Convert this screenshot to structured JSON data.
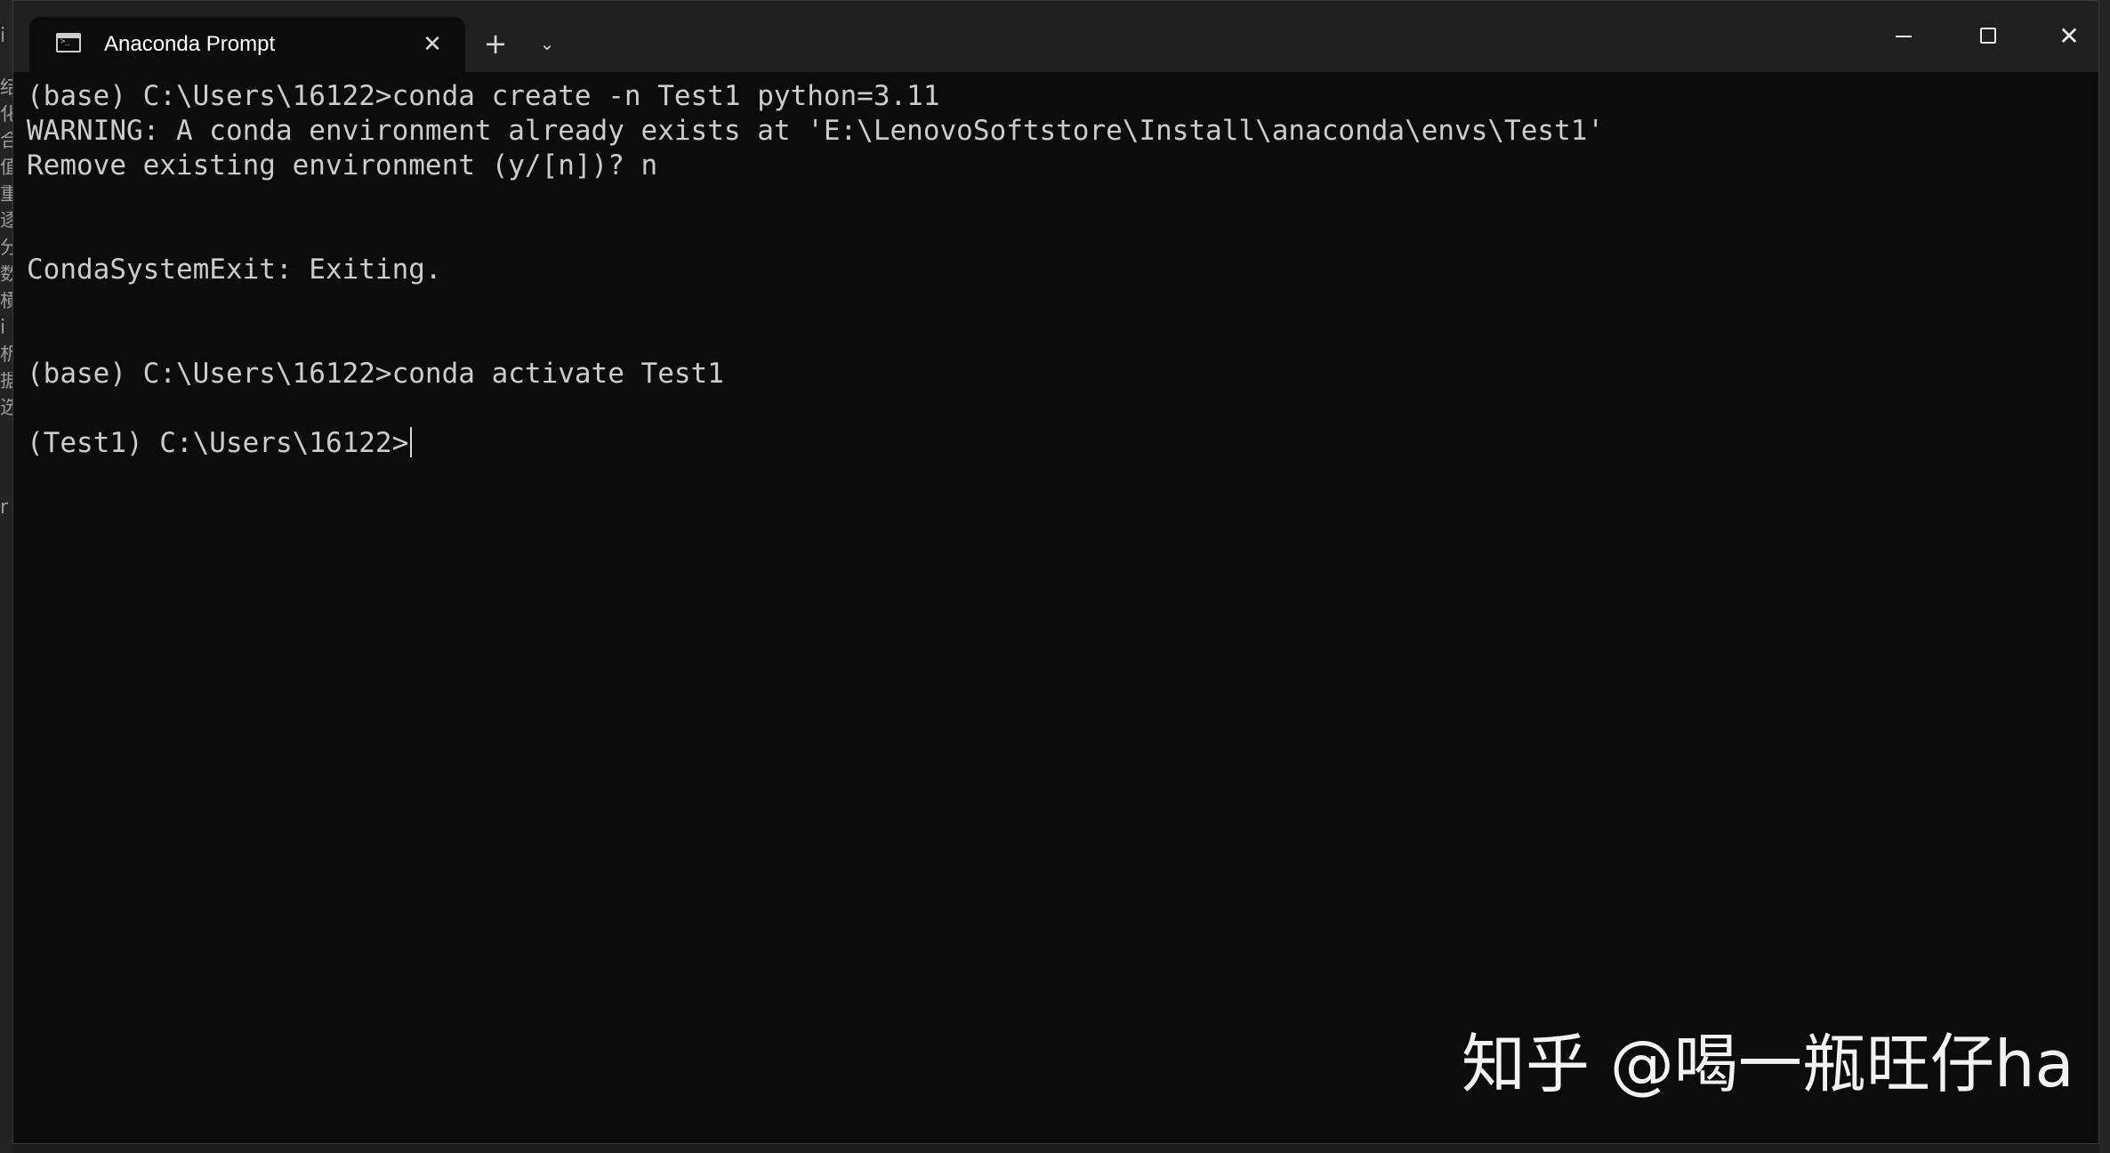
{
  "tab": {
    "title": "Anaconda Prompt",
    "icon": "terminal-icon",
    "close_glyph": "✕"
  },
  "titlebar": {
    "new_tab_glyph": "+",
    "dropdown_glyph": "⌄",
    "close_glyph": "✕"
  },
  "terminal": {
    "lines": [
      "(base) C:\\Users\\16122>conda create -n Test1 python=3.11",
      "WARNING: A conda environment already exists at 'E:\\LenovoSoftstore\\Install\\anaconda\\envs\\Test1'",
      "Remove existing environment (y/[n])? n",
      "CondaSystemExit: Exiting.",
      "(base) C:\\Users\\16122>conda activate Test1",
      "(Test1) C:\\Users\\16122>"
    ]
  },
  "watermark": {
    "text": "知乎 @喝一瓶旺仔ha"
  },
  "background_edge": {
    "chars": [
      "i",
      "结",
      "化",
      "合",
      "值",
      "重",
      "逐",
      "分",
      "数",
      "横",
      "i",
      "析",
      "据",
      "选",
      "r"
    ]
  },
  "colors": {
    "terminal_bg": "#0c0c0c",
    "titlebar_bg": "#202020",
    "text": "#cccccc"
  }
}
